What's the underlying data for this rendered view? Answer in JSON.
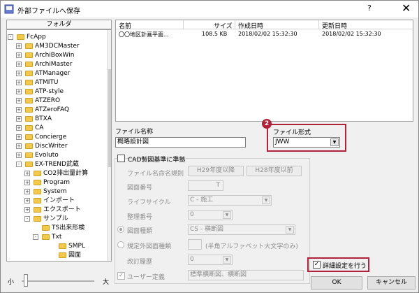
{
  "window": {
    "title": "外部ファイルへ保存",
    "help_label": "?",
    "close_label": "✕"
  },
  "folder_panel": {
    "header": "フォルダ",
    "tree": [
      {
        "label": "FcApp",
        "level": 0,
        "expander": "-"
      },
      {
        "label": "AM3DCMaster",
        "level": 1,
        "expander": "+"
      },
      {
        "label": "ArchiBoxWin",
        "level": 1,
        "expander": "+"
      },
      {
        "label": "ArchiMaster",
        "level": 1,
        "expander": "+"
      },
      {
        "label": "ATManager",
        "level": 1,
        "expander": "+"
      },
      {
        "label": "ATMITU",
        "level": 1,
        "expander": "+"
      },
      {
        "label": "ATP-style",
        "level": 1,
        "expander": "+"
      },
      {
        "label": "ATZERO",
        "level": 1,
        "expander": "+"
      },
      {
        "label": "ATZeroFAQ",
        "level": 1,
        "expander": "+"
      },
      {
        "label": "BTXA",
        "level": 1,
        "expander": "+"
      },
      {
        "label": "CA",
        "level": 1,
        "expander": "+"
      },
      {
        "label": "Concierge",
        "level": 1,
        "expander": "+"
      },
      {
        "label": "DiscWriter",
        "level": 1,
        "expander": "+"
      },
      {
        "label": "Evoluto",
        "level": 1,
        "expander": "+"
      },
      {
        "label": "EX-TREND武蔵",
        "level": 1,
        "expander": "-"
      },
      {
        "label": "CO2排出量計算",
        "level": 2,
        "expander": "+"
      },
      {
        "label": "Program",
        "level": 2,
        "expander": "+"
      },
      {
        "label": "System",
        "level": 2,
        "expander": "+"
      },
      {
        "label": "インポート",
        "level": 2,
        "expander": "+"
      },
      {
        "label": "エクスポート",
        "level": 2,
        "expander": "+"
      },
      {
        "label": "サンプル",
        "level": 2,
        "expander": "-"
      },
      {
        "label": "TS出来形検",
        "level": 3,
        "expander": ""
      },
      {
        "label": "Txt",
        "level": 3,
        "expander": "-"
      },
      {
        "label": "SMPL",
        "level": 4,
        "expander": ""
      },
      {
        "label": "図面",
        "level": 4,
        "expander": ""
      }
    ],
    "slider_small": "小",
    "slider_large": "大"
  },
  "file_list": {
    "columns": [
      "名前",
      "サイズ",
      "作成日時",
      "更新日時"
    ],
    "rows": [
      {
        "name": "〇〇地区計画平面...",
        "size": "108.5 KB",
        "created": "2018/02/02 15:32:30",
        "modified": "2018/02/02 15:32:30"
      }
    ]
  },
  "file_name": {
    "label": "ファイル名称",
    "value": "概略設計図"
  },
  "file_format": {
    "badge": "2",
    "label": "ファイル形式",
    "value": "JWW"
  },
  "cad_group": {
    "checkbox_label": "CAD製図基準に準拠",
    "naming_rule_label": "ファイル名命名規則",
    "h29_button": "H29年度以降",
    "h28_button": "H28年度以前",
    "drawing_number_label": "図面番号",
    "drawing_number_suffix": "T",
    "lifecycle_label": "ライフサイクル",
    "lifecycle_value": "C - 施工",
    "sort_number_label": "整理番号",
    "sort_number_value": "0",
    "drawing_type_label": "図面種類",
    "drawing_type_value": "CS - 横断図",
    "non_standard_label": "規定外図面種類",
    "non_standard_hint": "(半角アルファベット大文字のみ)",
    "revision_label": "改訂履歴",
    "revision_value": "0",
    "user_def_label": "ユーザー定義",
    "user_def_value": "標準横断図、横断図"
  },
  "detail_settings": {
    "label": "詳細設定を行う",
    "checked": true
  },
  "buttons": {
    "ok": "OK",
    "cancel": "キャンセル"
  },
  "colors": {
    "highlight": "#b0223a",
    "folder": "#f2c94c"
  }
}
